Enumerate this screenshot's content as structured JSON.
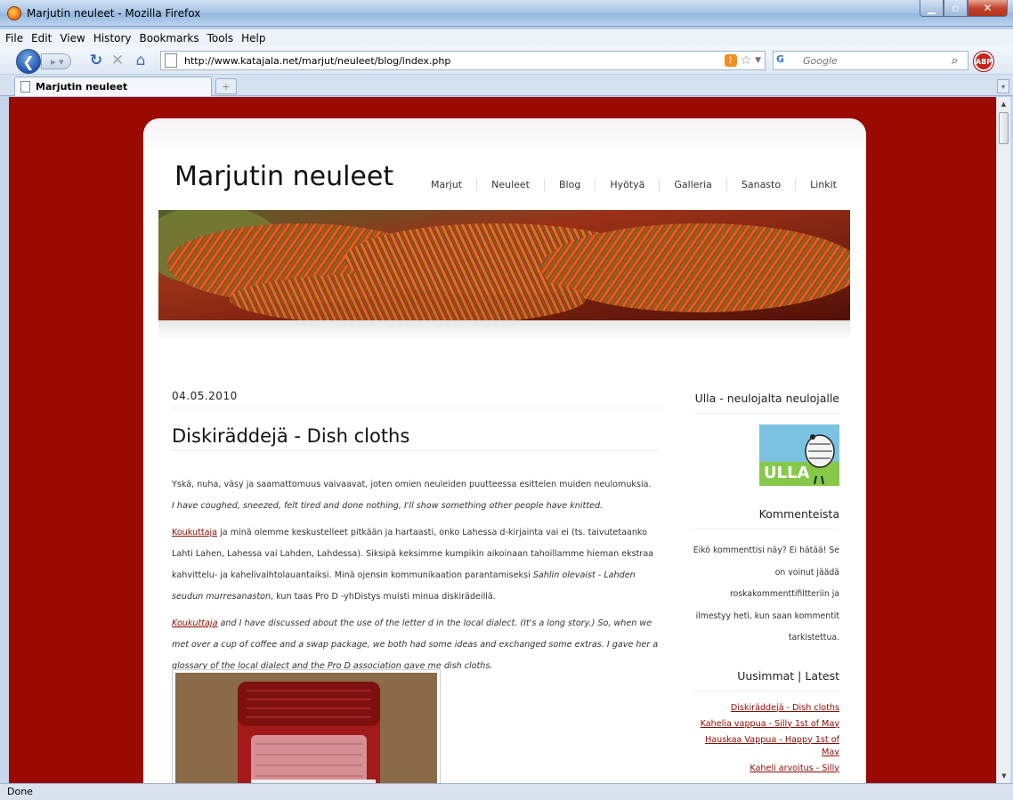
{
  "window": {
    "title": "Marjutin neuleet - Mozilla Firefox"
  },
  "menu": [
    "File",
    "Edit",
    "View",
    "History",
    "Bookmarks",
    "Tools",
    "Help"
  ],
  "nav": {
    "url": "http://www.katajala.net/marjut/neuleet/blog/index.php",
    "search_placeholder": "Google",
    "search_engine": "G"
  },
  "tab": {
    "label": "Marjutin neuleet",
    "new_tab": "+"
  },
  "status": "Done",
  "site": {
    "title": "Marjutin neuleet",
    "nav": [
      "Marjut",
      "Neuleet",
      "Blog",
      "Hyötyä",
      "Galleria",
      "Sanasto",
      "Linkit"
    ]
  },
  "post": {
    "date": "04.05.2010",
    "title": "Diskiräddejä - Dish cloths",
    "p1_fi": "Yskä, nuha, väsy ja saamattomuus vaivaavat, joten omien neuleiden puutteessa esittelen muiden neulomuksia.",
    "p1_en": "I have coughed, sneezed, felt tired and done nothing, I'll show something other people have knitted.",
    "p2_link": "Koukuttaja",
    "p2_a": " ja minä olemme keskustelleet pitkään ja hartaasti, onko Lahessa d-kirjainta vai ei (ts. taivutetaanko Lahti Lahen, Lahessa vai Lahden, Lahdessa). Siksipä keksimme kumpikin aikoinaan tahoillamme hieman ekstraa kahvittelu- ja kahelivaihtolauantaiksi. Minä ojensin kommunikaation parantamiseksi ",
    "p2_em": "Sahlin olevaist - Lahden seudun murresanaston",
    "p2_b": ", kun taas Pro D -yhDistys muisti minua diskirädeillä.",
    "p3_link": "Koukuttaja",
    "p3_text": " and I have discussed about the use of the letter d in the local dialect. (It's a long story.) So, when we met over a cup of coffee and a swap package, we both had some ideas and exchanged some extras. I gave her a glossary of the local dialect and the Pro D association gave me dish cloths."
  },
  "sidebar": {
    "h1": "Ulla - neulojalta neulojalle",
    "ulla_logo_text": "ULLA",
    "h2": "Kommenteista",
    "comment_text": "Eikö kommenttisi näy? Ei hätää! Se on voinut jäädä roskakommenttifiltteriin ja ilmestyy heti, kun saan kommentit tarkistettua.",
    "h3": "Uusimmat | Latest",
    "latest": [
      "Diskiräddejä - Dish cloths",
      "Kahelia vappua - Silly 1st of May",
      "Hauskaa Vappua - Happy 1st of May",
      "Kaheli arvoitus - Silly"
    ]
  },
  "colors": {
    "page_bg": "#9b0a00",
    "link": "#8d0a00"
  }
}
